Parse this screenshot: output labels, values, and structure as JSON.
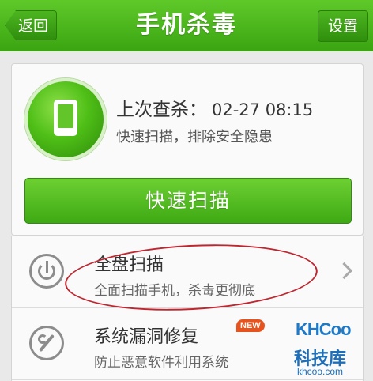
{
  "header": {
    "back_label": "返回",
    "title": "手机杀毒",
    "settings_label": "设置"
  },
  "status": {
    "last_scan_label": "上次查杀：",
    "last_scan_time": "02-27 08:15",
    "description": "快速扫描，排除安全隐患",
    "quick_scan_button": "快速扫描"
  },
  "list": {
    "items": [
      {
        "title": "全盘扫描",
        "subtitle": "全面扫描手机，杀毒更彻底",
        "icon": "disk-scan-icon"
      },
      {
        "title": "系统漏洞修复",
        "subtitle": "防止恶意软件利用系统",
        "badge": "NEW",
        "icon": "wrench-icon"
      }
    ]
  },
  "watermark": {
    "logo": "KHCoo",
    "name": "科技库",
    "url": "khcoo.com"
  },
  "colors": {
    "accent_green": "#3ea914",
    "badge_red": "#e8531d",
    "annotation_red": "#c0262f"
  }
}
